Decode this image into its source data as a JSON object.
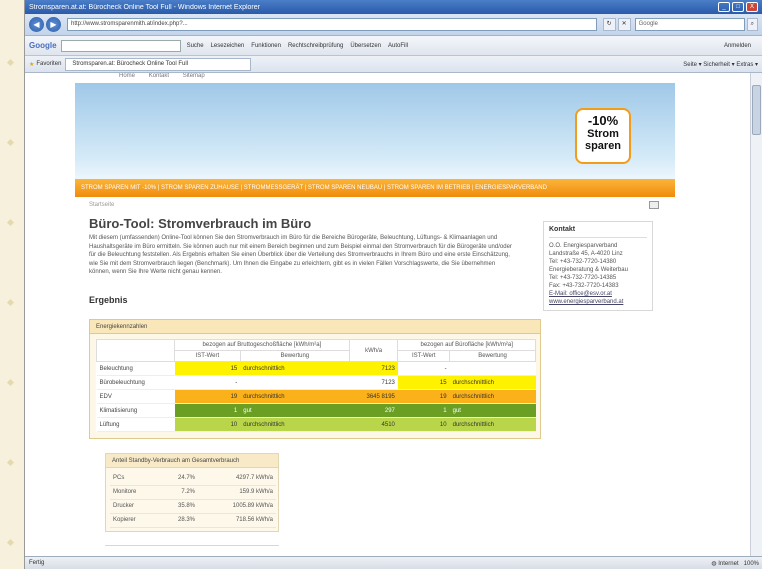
{
  "window": {
    "title": "Stromsparen.at.at: Bürocheck Online Tool Full - Windows Internet Explorer",
    "min": "_",
    "max": "□",
    "close": "X"
  },
  "address": {
    "url": "http://www.stromsparenmith.at/index.php?...",
    "search_placeholder": "Google"
  },
  "google_toolbar": {
    "logo": "Google",
    "items": [
      "Suche",
      "Lesezeichen",
      "Funktionen",
      "Rechtschreibprüfung",
      "Übersetzen",
      "AutoFill"
    ],
    "right": "Anmelden"
  },
  "favorites_bar": {
    "favorites": "Favoriten",
    "tab": "Stromsparen.at: Bürocheck Online Tool Full",
    "right": "Seite ▾   Sicherheit ▾   Extras ▾"
  },
  "site": {
    "topnav": [
      "Home",
      "Kontakt",
      "Sitemap"
    ],
    "logo_pct": "-10%",
    "logo_word1": "Strom",
    "logo_word2": "sparen",
    "orange_nav": "STROM SPAREN MIT -10% | STROM SPAREN ZUHAUSE | STROMMESSGERÄT | STROM SPAREN NEUBAU | STROM SPAREN IM BETRIEB | ENERGIESPARVERBAND",
    "breadcrumb": "Startseite",
    "title": "Büro-Tool: Stromverbrauch im Büro",
    "intro": "Mit diesem (umfassenden) Online-Tool können Sie den Stromverbrauch im Büro für die Bereiche Bürogeräte, Beleuchtung, Lüftungs- & Klimaanlagen und Haushaltsgeräte im Büro ermitteln. Sie können auch nur mit einem Bereich beginnen und zum Beispiel einmal den Stromverbrauch für die Bürogeräte und/oder für die Beleuchtung feststellen. Als Ergebnis erhalten Sie einen Überblick über die Verteilung des Stromverbrauchs in Ihrem Büro und eine erste Einschätzung, wie Sie mit dem Stromverbrauch liegen (Benchmark). Um Ihnen die Eingabe zu erleichtern, gibt es in vielen Fällen Vorschlagswerte, die Sie übernehmen können, wenn Sie Ihre Werte nicht genau kennen.",
    "result_heading": "Ergebnis"
  },
  "kontakt": {
    "heading": "Kontakt",
    "lines": [
      "O.Ö. Energiesparverband",
      "Landstraße 45, A-4020 Linz",
      "Tel: +43-732-7720-14380",
      "Energieberatung & Weiterbau",
      "Tel: +43-732-7720-14385",
      "Fax: +43-732-7720-14383",
      "E-Mail: office@esv.or.at"
    ],
    "link": "www.energiesparverband.at"
  },
  "energiekennzahlen": {
    "heading": "Energiekennzahlen",
    "col_group1": "bezogen auf Bruttogeschoßfläche [kWh/m²a]",
    "col_kwh": "kWh/a",
    "col_group2": "bezogen auf Bürofläche [kWh/m²a]",
    "sub_ist": "IST-Wert",
    "sub_bew": "Bewertung",
    "rows": [
      {
        "label": "Beleuchtung",
        "ist1": "15",
        "bew1": "durchschnittlich",
        "kwh": "7123",
        "ist2": "-",
        "bew2": ""
      },
      {
        "label": "Bürobeleuchtung",
        "ist1": "-",
        "bew1": "",
        "kwh": "7123",
        "ist2": "15",
        "bew2": "durchschnittlich"
      },
      {
        "label": "EDV",
        "ist1": "19",
        "bew1": "durchschnittlich",
        "kwh": "3645 8195",
        "ist2": "19",
        "bew2": "durchschnittlich"
      },
      {
        "label": "Klimatisierung",
        "ist1": "1",
        "bew1": "gut",
        "kwh": "297",
        "ist2": "1",
        "bew2": "gut"
      },
      {
        "label": "Lüftung",
        "ist1": "10",
        "bew1": "durchschnittlich",
        "kwh": "4510",
        "ist2": "10",
        "bew2": "durchschnittlich"
      }
    ]
  },
  "standby": {
    "heading": "Anteil Standby-Verbrauch am Gesamtverbrauch",
    "rows": [
      {
        "label": "PCs",
        "pct": "24.7%",
        "kwh": "4297.7 kWh/a"
      },
      {
        "label": "Monitore",
        "pct": "7.2%",
        "kwh": "159.9 kWh/a"
      },
      {
        "label": "Drucker",
        "pct": "35.8%",
        "kwh": "1005.89 kWh/a"
      },
      {
        "label": "Kopierer",
        "pct": "28.3%",
        "kwh": "718.56 kWh/a"
      }
    ]
  },
  "status": {
    "left": "Fertig",
    "zone": "Internet",
    "zoom": "100%"
  }
}
